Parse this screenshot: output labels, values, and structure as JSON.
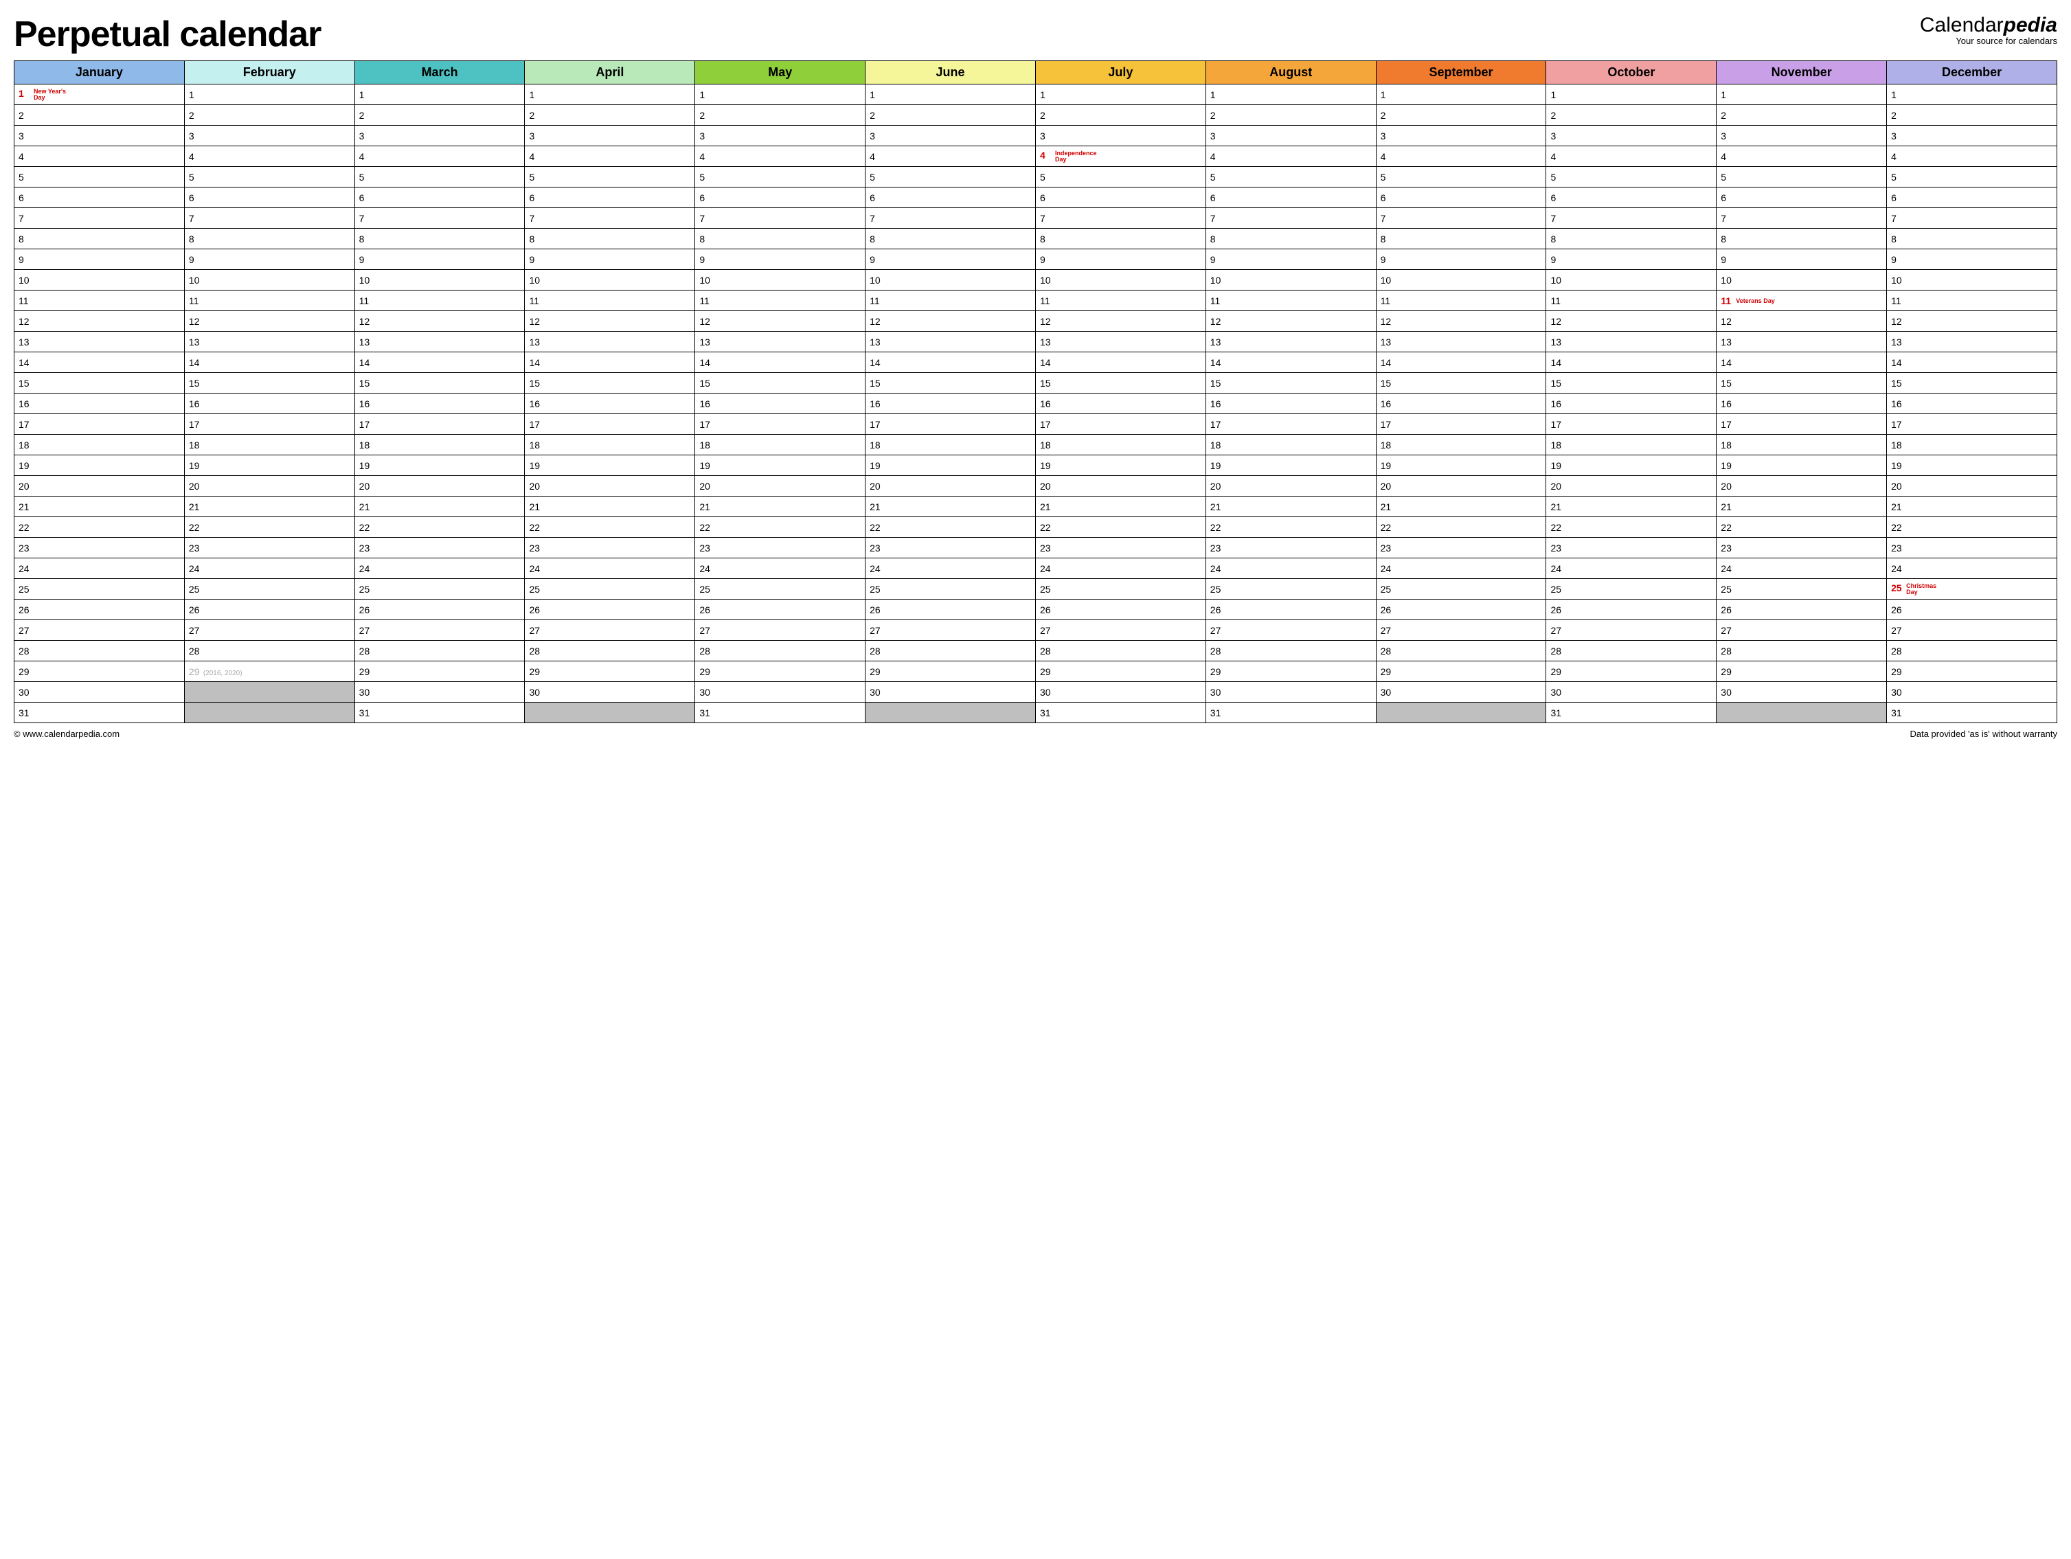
{
  "title": "Perpetual calendar",
  "brand": {
    "part1": "Calendar",
    "part2": "pedia",
    "tagline": "Your source for calendars"
  },
  "footer": {
    "left": "© www.calendarpedia.com",
    "right": "Data provided 'as is' without warranty"
  },
  "months": [
    {
      "name": "January",
      "bg": "#8fb9e8",
      "days": 31
    },
    {
      "name": "February",
      "bg": "#c4f0f0",
      "days": 28
    },
    {
      "name": "March",
      "bg": "#4ec2c2",
      "days": 31
    },
    {
      "name": "April",
      "bg": "#b9e8b9",
      "days": 30
    },
    {
      "name": "May",
      "bg": "#8fcf3a",
      "days": 31
    },
    {
      "name": "June",
      "bg": "#f5f59a",
      "days": 30
    },
    {
      "name": "July",
      "bg": "#f5c23a",
      "days": 31
    },
    {
      "name": "August",
      "bg": "#f5a63a",
      "days": 31
    },
    {
      "name": "September",
      "bg": "#f07a2e",
      "days": 30
    },
    {
      "name": "October",
      "bg": "#f0a0a0",
      "days": 31
    },
    {
      "name": "November",
      "bg": "#c9a0e8",
      "days": 30
    },
    {
      "name": "December",
      "bg": "#b0b0e8",
      "days": 31
    }
  ],
  "holidays": {
    "0": {
      "1": "New Year's Day"
    },
    "6": {
      "4": "Independence Day"
    },
    "10": {
      "11": "Veterans Day"
    },
    "11": {
      "25": "Christmas Day"
    }
  },
  "feb29": {
    "day": 29,
    "note": "(2016, 2020)"
  },
  "max_rows": 31
}
